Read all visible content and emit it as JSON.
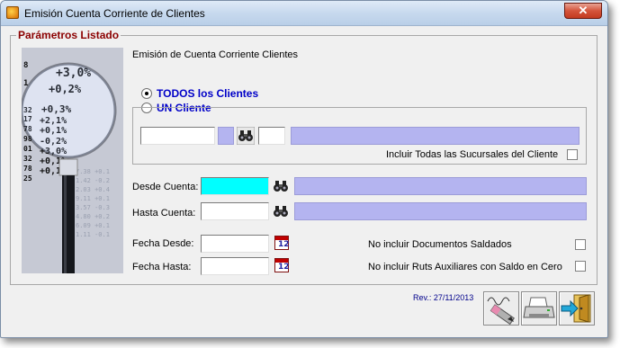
{
  "window": {
    "title": "Emisión Cuenta Corriente de Clientes",
    "close_label": "✕"
  },
  "panel": {
    "legend": "Parámetros Listado",
    "heading": "Emisión de Cuenta Corriente Clientes"
  },
  "client_selection": {
    "all_label": "TODOS los Clientes",
    "one_label": "UN Cliente",
    "selected": "all",
    "include_branches_label": "Incluir Todas las Sucursales del Cliente",
    "include_branches_checked": false
  },
  "account_range": {
    "from_label": "Desde Cuenta:",
    "to_label": "Hasta Cuenta:",
    "from_value": "",
    "to_value": ""
  },
  "dates": {
    "from_label": "Fecha Desde:",
    "to_label": "Fecha Hasta:",
    "from_value": "",
    "to_value": "",
    "calendar_icon_text": "12"
  },
  "options": {
    "exclude_paid_label": "No incluir Documentos Saldados",
    "exclude_paid_checked": false,
    "exclude_aux_label": "No incluir Ruts Auxiliares con Saldo en Cero",
    "exclude_aux_checked": false
  },
  "footer": {
    "revision": "Rev.:  27/11/2013"
  },
  "image_numbers": [
    "+3,0%",
    "+0,2%",
    "+0,3%",
    "+2,1%",
    "+0,1%",
    "-0,2%",
    "+3,0%",
    "+0,1%",
    "+0,1%"
  ],
  "image_prefixes": [
    "8",
    "1",
    "32",
    "17",
    "78",
    "98",
    "01",
    "32",
    "78",
    "25"
  ],
  "colors": {
    "legend_red": "#8b0000",
    "radio_blue": "#0000c8",
    "lavender": "#b4b4f0",
    "cyan_field": "#00ffff",
    "revision_blue": "#00008b"
  },
  "icons": [
    "app-icon",
    "binoculars-icon",
    "calendar-icon",
    "signature-pen-icon",
    "printer-icon",
    "exit-door-icon"
  ]
}
